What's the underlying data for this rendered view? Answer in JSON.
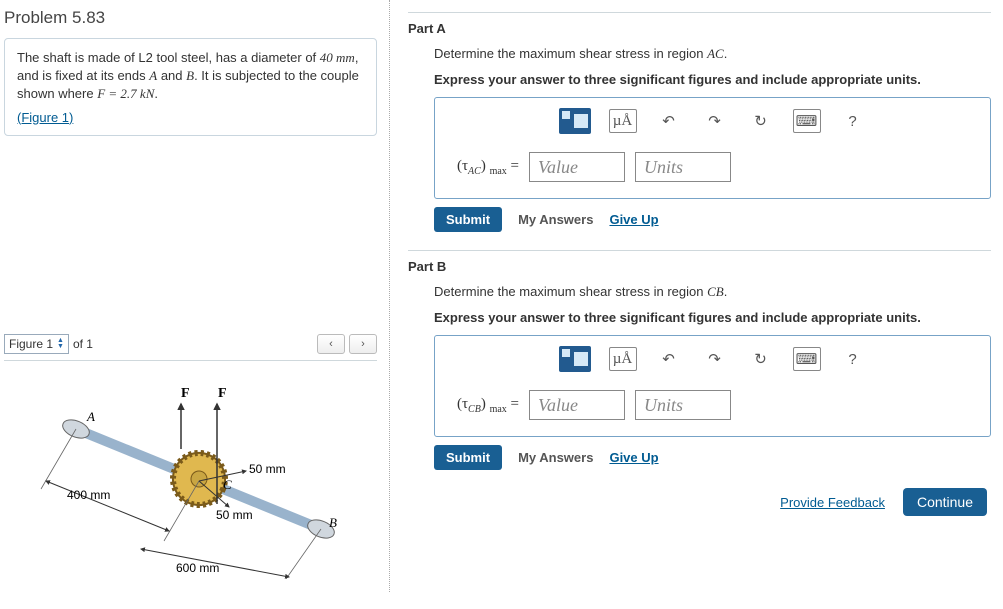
{
  "problem": {
    "title": "Problem 5.83",
    "text_before": "The shaft is made of L2 tool steel, has a diameter of ",
    "diam": "40 mm",
    "text_mid1": ", and is fixed at its ends ",
    "A": "A",
    "and": " and ",
    "B": "B",
    "text_mid2": ". It is subjected to the couple shown where ",
    "Feq": "F = 2.7 kN",
    "text_end": ".",
    "figure_link": "(Figure 1)"
  },
  "figSelector": {
    "label": "Figure 1",
    "of": "of 1",
    "prev": "‹",
    "next": "›"
  },
  "figure": {
    "F1": "F",
    "F2": "F",
    "ptA": "A",
    "ptB": "B",
    "ptC": "C",
    "d400": "400 mm",
    "d600": "600 mm",
    "d50a": "50 mm",
    "d50b": "50 mm"
  },
  "partA": {
    "title": "Part A",
    "prompt_pre": "Determine the maximum shear stress in region ",
    "prompt_reg": "AC",
    "prompt_post": ".",
    "instr": "Express your answer to three significant figures and include appropriate units.",
    "varPre": "(τ",
    "varSubReg": "AC",
    "varSubMax": "max",
    "varPost": ") ",
    "eq": " = ",
    "valuePH": "Value",
    "unitsPH": "Units"
  },
  "partB": {
    "title": "Part B",
    "prompt_pre": "Determine the maximum shear stress in region ",
    "prompt_reg": "CB",
    "prompt_post": ".",
    "instr": "Express your answer to three significant figures and include appropriate units.",
    "varPre": "(τ",
    "varSubReg": "CB",
    "varSubMax": "max",
    "varPost": ") ",
    "eq": " = ",
    "valuePH": "Value",
    "unitsPH": "Units"
  },
  "toolbar": {
    "mua": "µÅ",
    "undo": "↶",
    "redo": "↷",
    "reset": "↻",
    "keyboard": "⌨",
    "help": "?"
  },
  "actions": {
    "submit": "Submit",
    "myAnswers": "My Answers",
    "giveUp": "Give Up",
    "provideFeedback": "Provide Feedback",
    "continue": "Continue"
  }
}
